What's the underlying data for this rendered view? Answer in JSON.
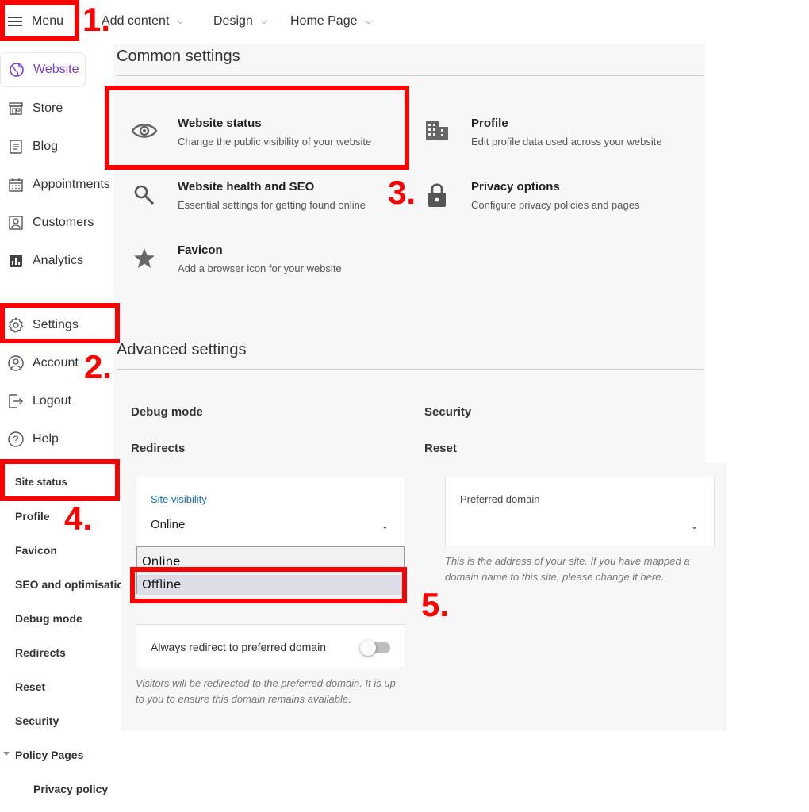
{
  "topbar": {
    "menu_label": "Menu",
    "add_content_label": "Add content",
    "design_label": "Design",
    "home_page_label": "Home Page"
  },
  "sidebar": {
    "primary_items": [
      {
        "label": "Website",
        "icon": "globe-icon",
        "active": true
      },
      {
        "label": "Store",
        "icon": "store-icon"
      },
      {
        "label": "Blog",
        "icon": "document-icon"
      },
      {
        "label": "Appointments",
        "icon": "calendar-icon"
      },
      {
        "label": "Customers",
        "icon": "contact-card-icon"
      },
      {
        "label": "Analytics",
        "icon": "bar-chart-icon"
      }
    ],
    "secondary_items": [
      {
        "label": "Settings",
        "icon": "gear-icon"
      },
      {
        "label": "Account",
        "icon": "user-circle-icon"
      },
      {
        "label": "Logout",
        "icon": "logout-icon"
      },
      {
        "label": "Help",
        "icon": "help-circle-icon"
      }
    ],
    "sub_items": [
      "Site status",
      "Profile",
      "Favicon",
      "SEO and optimisation",
      "Debug mode",
      "Redirects",
      "Reset",
      "Security",
      "Policy Pages",
      "Privacy policy"
    ]
  },
  "common_settings": {
    "title": "Common settings",
    "items": [
      {
        "title": "Website status",
        "desc": "Change the public visibility of your website",
        "icon": "eye-icon"
      },
      {
        "title": "Profile",
        "desc": "Edit profile data used across your website",
        "icon": "building-icon"
      },
      {
        "title": "Website health and SEO",
        "desc": "Essential settings for getting found online",
        "icon": "search-icon"
      },
      {
        "title": "Privacy options",
        "desc": "Configure privacy policies and pages",
        "icon": "lock-icon"
      },
      {
        "title": "Favicon",
        "desc": "Add a browser icon for your website",
        "icon": "star-icon"
      }
    ]
  },
  "advanced_settings": {
    "title": "Advanced settings",
    "links": [
      "Debug mode",
      "Security",
      "Redirects",
      "Reset"
    ]
  },
  "site_status_form": {
    "visibility_label": "Site visibility",
    "visibility_value": "Online",
    "options": [
      "Online",
      "Offline"
    ],
    "domain_label": "Preferred domain",
    "domain_value": "",
    "domain_hint": "This is the address of your site. If you have mapped a domain name to this site, please change it here.",
    "redirect_label": "Always redirect to preferred domain",
    "redirect_enabled": false,
    "redirect_hint": "Visitors will be redirected to the preferred domain. It is up to you to ensure this domain remains available."
  },
  "annotations": [
    "1.",
    "2.",
    "3.",
    "4.",
    "5."
  ],
  "colors": {
    "accent": "#7a3fc8",
    "annotation_red": "#ff0000",
    "link_blue": "#1a6fb5",
    "panel_bg": "#f7f7f7"
  }
}
